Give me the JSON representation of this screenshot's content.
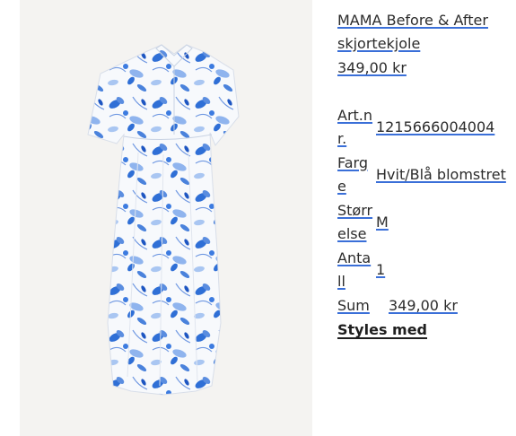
{
  "product": {
    "name": "MAMA Before & After skjortekjole",
    "price": "349,00 kr",
    "image_alt": "Blue and white floral shirt dress"
  },
  "specs": [
    {
      "key": "Art.nr.",
      "value": "1215666004004"
    },
    {
      "key": "Farge",
      "value": "Hvit/Blå blomstret"
    },
    {
      "key": "Størrelse",
      "value": "M"
    },
    {
      "key": "Antall",
      "value": "1"
    }
  ],
  "summary": {
    "sum_label": "Sum",
    "sum_value": "349,00 kr"
  },
  "styles_link": "Styles med",
  "colors": {
    "image_background": "#f4f3f1",
    "dress_base": "#f7f9fc",
    "floral_primary": "#2f6fd6",
    "floral_light": "#8fb4ee",
    "link_underline": "#3a6fd8"
  }
}
